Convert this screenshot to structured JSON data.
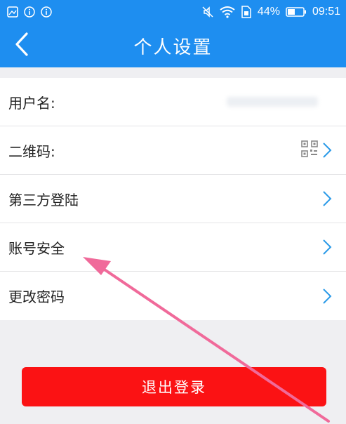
{
  "status_bar": {
    "battery_percent": "44%",
    "time": "09:51"
  },
  "header": {
    "title": "个人设置"
  },
  "settings": {
    "rows": [
      {
        "label": "用户名:"
      },
      {
        "label": "二维码:"
      },
      {
        "label": "第三方登陆"
      },
      {
        "label": "账号安全"
      },
      {
        "label": "更改密码"
      }
    ]
  },
  "logout": {
    "label": "退出登录"
  },
  "colors": {
    "header_blue": "#1e8ef0",
    "logout_red": "#fb1214",
    "chevron_blue": "#2a9ae8",
    "annotation_pink": "#f06a9a"
  }
}
